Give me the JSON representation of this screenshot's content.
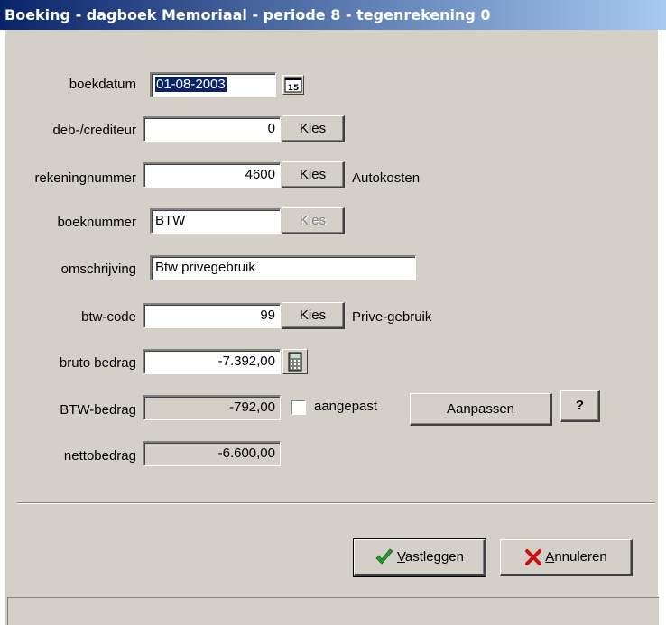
{
  "window": {
    "title": "Boeking - dagboek Memoriaal - periode 8 - tegenrekening 0"
  },
  "form": {
    "boekdatum": {
      "label": "boekdatum",
      "value": "01-08-2003",
      "date_icon_text": "15"
    },
    "debcred": {
      "label": "deb-/crediteur",
      "value": "0",
      "button": "Kies"
    },
    "rekening": {
      "label": "rekeningnummer",
      "value": "4600",
      "button": "Kies",
      "description": "Autokosten"
    },
    "boeknummer": {
      "label": "boeknummer",
      "value": "BTW",
      "button": "Kies"
    },
    "omschrijving": {
      "label": "omschrijving",
      "value": "Btw privegebruik"
    },
    "btwcode": {
      "label": "btw-code",
      "value": "99",
      "button": "Kies",
      "description": "Prive-gebruik"
    },
    "bruto": {
      "label": "bruto bedrag",
      "value": "-7.392,00"
    },
    "btw": {
      "label": "BTW-bedrag",
      "value": "-792,00",
      "checkbox_label": "aangepast",
      "aanpassen": "Aanpassen",
      "help": "?"
    },
    "netto": {
      "label": "nettobedrag",
      "value": "-6.600,00"
    }
  },
  "actions": {
    "vastleggen": {
      "underline": "V",
      "rest": "astleggen"
    },
    "annuleren": {
      "underline": "A",
      "rest": "nnuleren"
    }
  },
  "icons": {
    "date": "calendar-icon",
    "calculator": "calculator-icon",
    "ok": "checkmark-icon",
    "cancel": "x-icon"
  }
}
